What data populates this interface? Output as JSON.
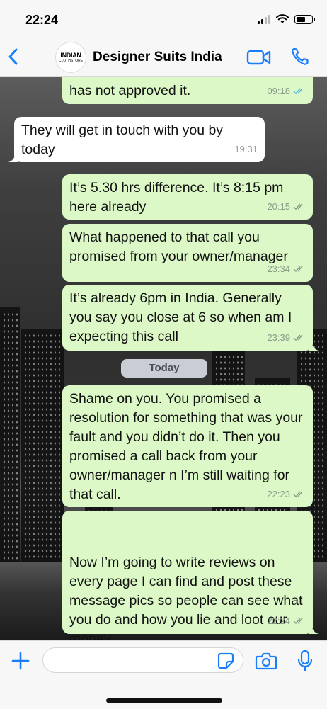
{
  "status_bar": {
    "time": "22:24"
  },
  "header": {
    "contact_name": "Designer Suits India",
    "avatar_text_top": "INDIAN",
    "avatar_text_bottom": "CLOTHSTORE"
  },
  "colors": {
    "outgoing_bubble": "#dcf8c6",
    "incoming_bubble": "#ffffff",
    "accent_blue": "#1a7efb",
    "read_tick_blue": "#4fb6ec"
  },
  "messages": [
    {
      "direction": "out",
      "text": "has not approved it.",
      "time": "09:18",
      "status": "read"
    },
    {
      "direction": "in",
      "text": "They will get in touch with you by today",
      "time": "19:31"
    },
    {
      "direction": "out",
      "text": "It’s 5.30 hrs difference. It’s 8:15 pm here already",
      "time": "20:15",
      "status": "delivered"
    },
    {
      "direction": "out",
      "text": "What happened to that call you promised from your owner/manager",
      "time": "23:34",
      "status": "delivered"
    },
    {
      "direction": "out",
      "text": "It’s already 6pm in India. Generally you say you close at 6 so when am I expecting this call",
      "time": "23:39",
      "status": "delivered"
    },
    {
      "direction": "out",
      "text": "Shame on you. You promised a resolution for something that was your fault and you didn’t do it. Then you promised a call back from your owner/manager n I’m still waiting for that call.",
      "time": "22:23",
      "status": "delivered"
    },
    {
      "direction": "out",
      "text": "Now I’m going to write reviews on every page I can find and post these message pics so people can see what you do and how you lie and loot our money.\nAbsolutely disgraceful.",
      "time": "22:24",
      "status": "delivered"
    }
  ],
  "day_separator": "Today",
  "icons": {
    "back": "chevron-left-icon",
    "video": "video-camera-icon",
    "call": "phone-icon",
    "attach": "plus-icon",
    "sticker": "sticker-icon",
    "camera": "camera-icon",
    "mic": "microphone-icon"
  }
}
